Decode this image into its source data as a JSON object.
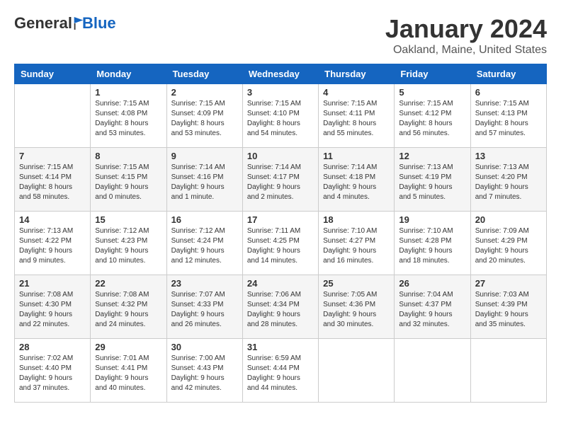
{
  "header": {
    "logo_general": "General",
    "logo_blue": "Blue",
    "month_title": "January 2024",
    "location": "Oakland, Maine, United States"
  },
  "days_of_week": [
    "Sunday",
    "Monday",
    "Tuesday",
    "Wednesday",
    "Thursday",
    "Friday",
    "Saturday"
  ],
  "weeks": [
    [
      {
        "day": "",
        "sunrise": "",
        "sunset": "",
        "daylight": ""
      },
      {
        "day": "1",
        "sunrise": "Sunrise: 7:15 AM",
        "sunset": "Sunset: 4:08 PM",
        "daylight": "Daylight: 8 hours and 53 minutes."
      },
      {
        "day": "2",
        "sunrise": "Sunrise: 7:15 AM",
        "sunset": "Sunset: 4:09 PM",
        "daylight": "Daylight: 8 hours and 53 minutes."
      },
      {
        "day": "3",
        "sunrise": "Sunrise: 7:15 AM",
        "sunset": "Sunset: 4:10 PM",
        "daylight": "Daylight: 8 hours and 54 minutes."
      },
      {
        "day": "4",
        "sunrise": "Sunrise: 7:15 AM",
        "sunset": "Sunset: 4:11 PM",
        "daylight": "Daylight: 8 hours and 55 minutes."
      },
      {
        "day": "5",
        "sunrise": "Sunrise: 7:15 AM",
        "sunset": "Sunset: 4:12 PM",
        "daylight": "Daylight: 8 hours and 56 minutes."
      },
      {
        "day": "6",
        "sunrise": "Sunrise: 7:15 AM",
        "sunset": "Sunset: 4:13 PM",
        "daylight": "Daylight: 8 hours and 57 minutes."
      }
    ],
    [
      {
        "day": "7",
        "sunrise": "Sunrise: 7:15 AM",
        "sunset": "Sunset: 4:14 PM",
        "daylight": "Daylight: 8 hours and 58 minutes."
      },
      {
        "day": "8",
        "sunrise": "Sunrise: 7:15 AM",
        "sunset": "Sunset: 4:15 PM",
        "daylight": "Daylight: 9 hours and 0 minutes."
      },
      {
        "day": "9",
        "sunrise": "Sunrise: 7:14 AM",
        "sunset": "Sunset: 4:16 PM",
        "daylight": "Daylight: 9 hours and 1 minute."
      },
      {
        "day": "10",
        "sunrise": "Sunrise: 7:14 AM",
        "sunset": "Sunset: 4:17 PM",
        "daylight": "Daylight: 9 hours and 2 minutes."
      },
      {
        "day": "11",
        "sunrise": "Sunrise: 7:14 AM",
        "sunset": "Sunset: 4:18 PM",
        "daylight": "Daylight: 9 hours and 4 minutes."
      },
      {
        "day": "12",
        "sunrise": "Sunrise: 7:13 AM",
        "sunset": "Sunset: 4:19 PM",
        "daylight": "Daylight: 9 hours and 5 minutes."
      },
      {
        "day": "13",
        "sunrise": "Sunrise: 7:13 AM",
        "sunset": "Sunset: 4:20 PM",
        "daylight": "Daylight: 9 hours and 7 minutes."
      }
    ],
    [
      {
        "day": "14",
        "sunrise": "Sunrise: 7:13 AM",
        "sunset": "Sunset: 4:22 PM",
        "daylight": "Daylight: 9 hours and 9 minutes."
      },
      {
        "day": "15",
        "sunrise": "Sunrise: 7:12 AM",
        "sunset": "Sunset: 4:23 PM",
        "daylight": "Daylight: 9 hours and 10 minutes."
      },
      {
        "day": "16",
        "sunrise": "Sunrise: 7:12 AM",
        "sunset": "Sunset: 4:24 PM",
        "daylight": "Daylight: 9 hours and 12 minutes."
      },
      {
        "day": "17",
        "sunrise": "Sunrise: 7:11 AM",
        "sunset": "Sunset: 4:25 PM",
        "daylight": "Daylight: 9 hours and 14 minutes."
      },
      {
        "day": "18",
        "sunrise": "Sunrise: 7:10 AM",
        "sunset": "Sunset: 4:27 PM",
        "daylight": "Daylight: 9 hours and 16 minutes."
      },
      {
        "day": "19",
        "sunrise": "Sunrise: 7:10 AM",
        "sunset": "Sunset: 4:28 PM",
        "daylight": "Daylight: 9 hours and 18 minutes."
      },
      {
        "day": "20",
        "sunrise": "Sunrise: 7:09 AM",
        "sunset": "Sunset: 4:29 PM",
        "daylight": "Daylight: 9 hours and 20 minutes."
      }
    ],
    [
      {
        "day": "21",
        "sunrise": "Sunrise: 7:08 AM",
        "sunset": "Sunset: 4:30 PM",
        "daylight": "Daylight: 9 hours and 22 minutes."
      },
      {
        "day": "22",
        "sunrise": "Sunrise: 7:08 AM",
        "sunset": "Sunset: 4:32 PM",
        "daylight": "Daylight: 9 hours and 24 minutes."
      },
      {
        "day": "23",
        "sunrise": "Sunrise: 7:07 AM",
        "sunset": "Sunset: 4:33 PM",
        "daylight": "Daylight: 9 hours and 26 minutes."
      },
      {
        "day": "24",
        "sunrise": "Sunrise: 7:06 AM",
        "sunset": "Sunset: 4:34 PM",
        "daylight": "Daylight: 9 hours and 28 minutes."
      },
      {
        "day": "25",
        "sunrise": "Sunrise: 7:05 AM",
        "sunset": "Sunset: 4:36 PM",
        "daylight": "Daylight: 9 hours and 30 minutes."
      },
      {
        "day": "26",
        "sunrise": "Sunrise: 7:04 AM",
        "sunset": "Sunset: 4:37 PM",
        "daylight": "Daylight: 9 hours and 32 minutes."
      },
      {
        "day": "27",
        "sunrise": "Sunrise: 7:03 AM",
        "sunset": "Sunset: 4:39 PM",
        "daylight": "Daylight: 9 hours and 35 minutes."
      }
    ],
    [
      {
        "day": "28",
        "sunrise": "Sunrise: 7:02 AM",
        "sunset": "Sunset: 4:40 PM",
        "daylight": "Daylight: 9 hours and 37 minutes."
      },
      {
        "day": "29",
        "sunrise": "Sunrise: 7:01 AM",
        "sunset": "Sunset: 4:41 PM",
        "daylight": "Daylight: 9 hours and 40 minutes."
      },
      {
        "day": "30",
        "sunrise": "Sunrise: 7:00 AM",
        "sunset": "Sunset: 4:43 PM",
        "daylight": "Daylight: 9 hours and 42 minutes."
      },
      {
        "day": "31",
        "sunrise": "Sunrise: 6:59 AM",
        "sunset": "Sunset: 4:44 PM",
        "daylight": "Daylight: 9 hours and 44 minutes."
      },
      {
        "day": "",
        "sunrise": "",
        "sunset": "",
        "daylight": ""
      },
      {
        "day": "",
        "sunrise": "",
        "sunset": "",
        "daylight": ""
      },
      {
        "day": "",
        "sunrise": "",
        "sunset": "",
        "daylight": ""
      }
    ]
  ]
}
